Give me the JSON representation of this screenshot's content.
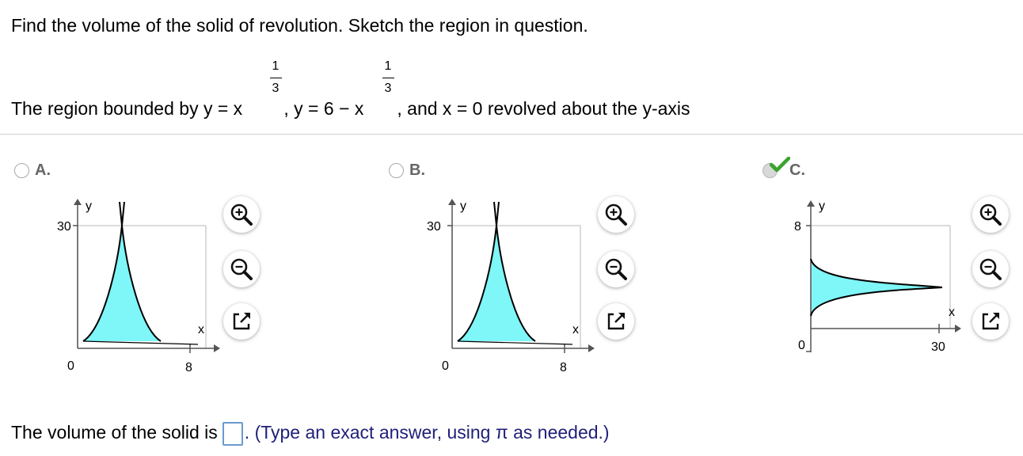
{
  "question": {
    "instruction": "Find the volume of the solid of revolution. Sketch the region in question.",
    "region_prefix": "The region bounded by y = x",
    "region_mid": " , y = 6 − x",
    "region_suffix": " , and x = 0 revolved about the y-axis",
    "exponent_num": "1",
    "exponent_den": "3"
  },
  "options": [
    {
      "label": "A.",
      "selected": false,
      "y_tick": "30",
      "x_tick_origin": "0",
      "x_tick_end": "8",
      "x_axis": "x",
      "y_axis": "y"
    },
    {
      "label": "B.",
      "selected": false,
      "y_tick": "30",
      "x_tick_origin": "0",
      "x_tick_end": "8",
      "x_axis": "x",
      "y_axis": "y"
    },
    {
      "label": "C.",
      "selected": true,
      "y_tick": "8",
      "x_tick_origin": "0",
      "x_tick_end": "30",
      "x_axis": "x",
      "y_axis": "y"
    }
  ],
  "tools": {
    "zoom_in": "zoom-in-icon",
    "zoom_out": "zoom-out-icon",
    "popout": "popout-icon"
  },
  "answer": {
    "prefix": "The volume of the solid is",
    "value": "",
    "hint": ". (Type an exact answer, using π as needed.)"
  },
  "colors": {
    "fill": "#7ff6f8",
    "selected_check": "#3aa32f",
    "hint_text": "#1f1f7a"
  }
}
